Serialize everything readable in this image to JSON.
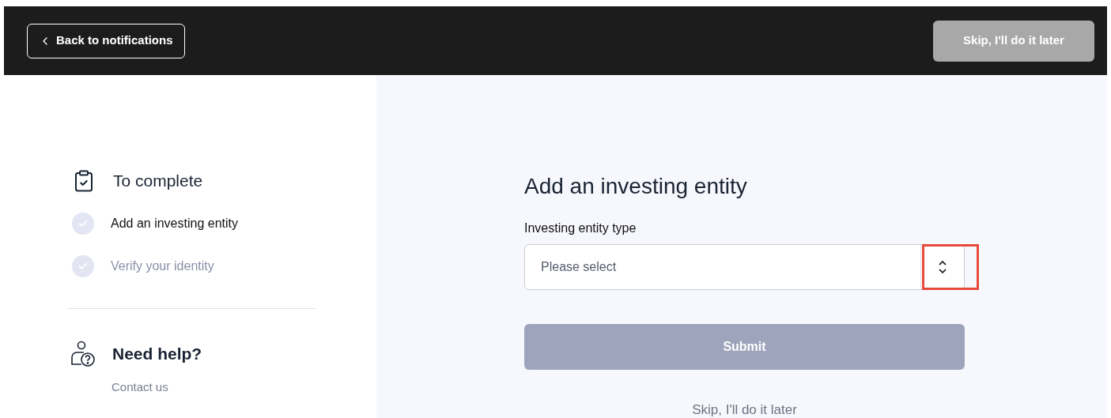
{
  "header": {
    "back_button": "Back to notifications",
    "skip_button": {
      "label": "Skip, I'll do it later",
      "disabled": true
    }
  },
  "sidebar": {
    "title": "To complete",
    "steps": [
      {
        "label": "Add an investing entity",
        "active": true
      },
      {
        "label": "Verify your identity",
        "active": false
      }
    ],
    "help": {
      "title": "Need help?",
      "link": "Contact us"
    }
  },
  "form": {
    "title": "Add an investing entity",
    "field_label": "Investing entity type",
    "select": {
      "placeholder": "Please select",
      "highlighted": true
    },
    "submit": {
      "label": "Submit",
      "disabled": true
    },
    "skip_link": "Skip, I'll do it later"
  }
}
